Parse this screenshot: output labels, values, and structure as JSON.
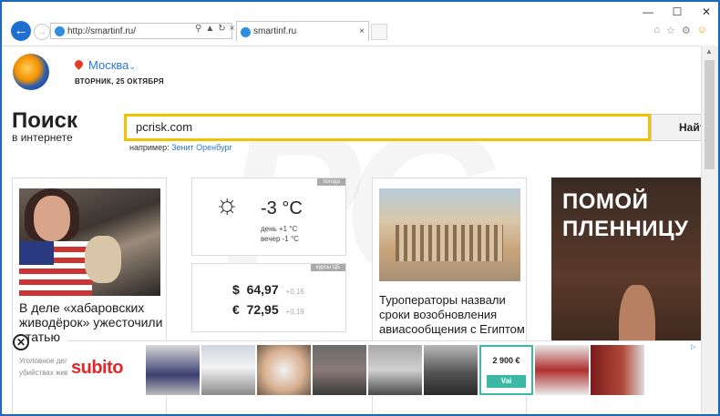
{
  "browser": {
    "url": "http://smartinf.ru/",
    "tab_title": "smartinf.ru",
    "tab_close": "×",
    "window_controls": [
      "—",
      "☐",
      "✕"
    ]
  },
  "page": {
    "city": "Москва",
    "date": "ВТОРНИК, 25 ОКТЯБРЯ",
    "brand_line1": "Поиск",
    "brand_line2": "в интернете",
    "search_value": "pcrisk.com",
    "search_button": "Найти",
    "example_label": "например:",
    "example_link": "Зенит Оренбург"
  },
  "news1": {
    "title": "В деле «хабаровских живодёрок» ужесточили статью",
    "snippet": "Уголовное дело хабаровчанок, которые убийствах живодерства"
  },
  "weather": {
    "tag": "погода",
    "temp": "-3 °C",
    "day": "день +1 °C",
    "evening": "вечер -1 °C"
  },
  "currency": {
    "tag": "курсы ЦБ",
    "usd_symbol": "$",
    "usd": "64,97",
    "usd_change": "+0,16",
    "eur_symbol": "€",
    "eur": "72,95",
    "eur_change": "+0,19"
  },
  "news2": {
    "title": "Туроператоры назвали сроки возобновления авиасообщения с Египтом"
  },
  "ad_banner": {
    "text": "ПОМОЙ ПЛЕННИЦУ"
  },
  "overlay_ad": {
    "brand": "subito",
    "price": "2 900 €",
    "cta": "Vai",
    "close": "✕"
  },
  "colors": {
    "accent": "#2b78d0",
    "search_border": "#f2c100",
    "brand_red": "#e3262a",
    "subito_teal": "#3bb9a6"
  }
}
